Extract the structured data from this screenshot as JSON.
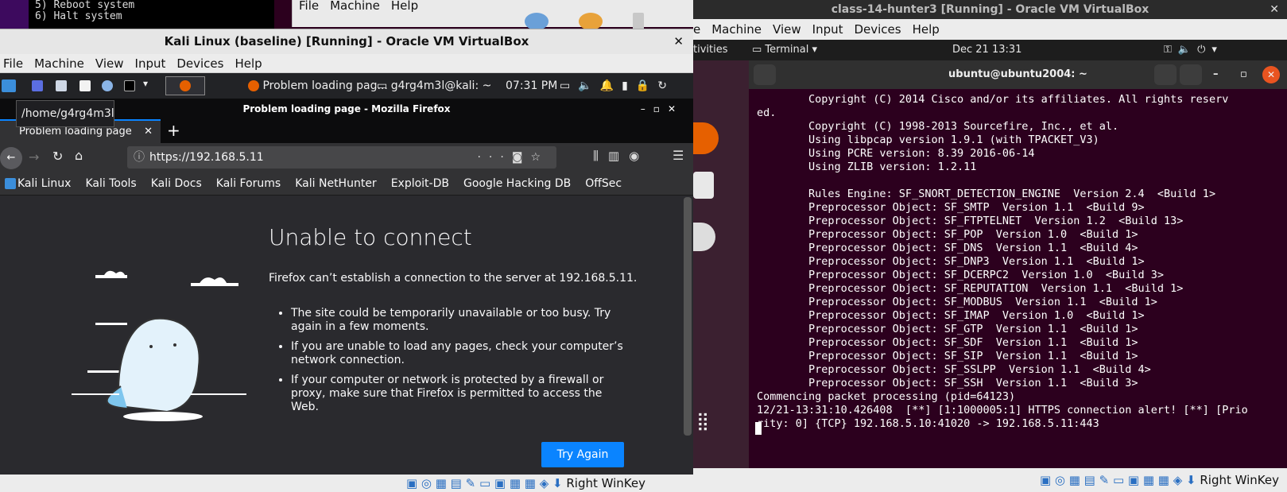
{
  "bg_terminal": {
    "lines": [
      "5) Reboot system",
      "6) Halt system"
    ]
  },
  "bg_vbox_menu": [
    "File",
    "Machine",
    "Help"
  ],
  "ubuntu_vm": {
    "window_title": "class-14-hunter3 [Running] - Oracle VM VirtualBox",
    "menu": [
      "e",
      "Machine",
      "View",
      "Input",
      "Devices",
      "Help"
    ],
    "gnome": {
      "activities": "tivities",
      "terminal_label": "Terminal",
      "clock": "Dec 21  13:31"
    },
    "terminal_title": "ubuntu@ubuntu2004: ~",
    "terminal_lines": [
      "        Copyright (C) 2014 Cisco and/or its affiliates. All rights reserv",
      "ed.",
      "        Copyright (C) 1998-2013 Sourcefire, Inc., et al.",
      "        Using libpcap version 1.9.1 (with TPACKET_V3)",
      "        Using PCRE version: 8.39 2016-06-14",
      "        Using ZLIB version: 1.2.11",
      "",
      "        Rules Engine: SF_SNORT_DETECTION_ENGINE  Version 2.4  <Build 1>",
      "        Preprocessor Object: SF_SMTP  Version 1.1  <Build 9>",
      "        Preprocessor Object: SF_FTPTELNET  Version 1.2  <Build 13>",
      "        Preprocessor Object: SF_POP  Version 1.0  <Build 1>",
      "        Preprocessor Object: SF_DNS  Version 1.1  <Build 4>",
      "        Preprocessor Object: SF_DNP3  Version 1.1  <Build 1>",
      "        Preprocessor Object: SF_DCERPC2  Version 1.0  <Build 3>",
      "        Preprocessor Object: SF_REPUTATION  Version 1.1  <Build 1>",
      "        Preprocessor Object: SF_MODBUS  Version 1.1  <Build 1>",
      "        Preprocessor Object: SF_IMAP  Version 1.0  <Build 1>",
      "        Preprocessor Object: SF_GTP  Version 1.1  <Build 1>",
      "        Preprocessor Object: SF_SDF  Version 1.1  <Build 1>",
      "        Preprocessor Object: SF_SIP  Version 1.1  <Build 1>",
      "        Preprocessor Object: SF_SSLPP  Version 1.1  <Build 4>",
      "        Preprocessor Object: SF_SSH  Version 1.1  <Build 3>",
      "Commencing packet processing (pid=64123)",
      "12/21-13:31:10.426408  [**] [1:1000005:1] HTTPS connection alert! [**] [Prio",
      "rity: 0] {TCP} 192.168.5.10:41020 -> 192.168.5.11:443"
    ],
    "host_key": "Right WinKey"
  },
  "kali_vm": {
    "window_title": "Kali Linux (baseline) [Running] - Oracle VM VirtualBox",
    "menu": [
      "File",
      "Machine",
      "View",
      "Input",
      "Devices",
      "Help"
    ],
    "taskbar": {
      "task1": "Problem loading pag...",
      "task2": "g4rg4m3l@kali: ~",
      "clock": "07:31 PM"
    },
    "tooltip": "/home/g4rg4m3l",
    "ff_title": "Problem loading page - Mozilla Firefox",
    "tab_label": "Problem loading page",
    "url": "https://192.168.5.11",
    "bookmarks": [
      "Kali Linux",
      "Kali Tools",
      "Kali Docs",
      "Kali Forums",
      "Kali NetHunter",
      "Exploit-DB",
      "Google Hacking DB",
      "OffSec"
    ],
    "error": {
      "title": "Unable to connect",
      "desc": "Firefox can’t establish a connection to the server at 192.168.5.11.",
      "bullets": [
        "The site could be temporarily unavailable or too busy. Try again in a few moments.",
        "If you are unable to load any pages, check your computer’s network connection.",
        "If your computer or network is protected by a firewall or proxy, make sure that Firefox is permitted to access the Web."
      ],
      "button": "Try Again"
    },
    "host_key": "Right WinKey"
  }
}
